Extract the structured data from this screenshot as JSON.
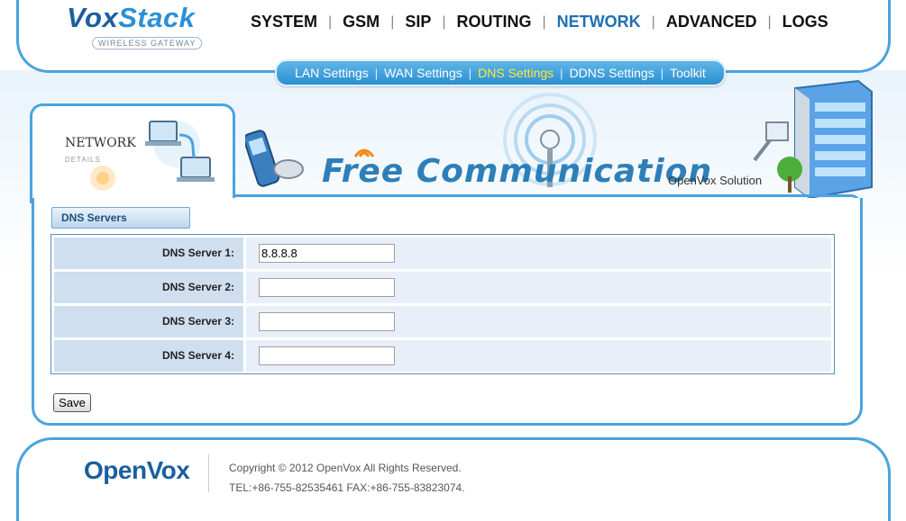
{
  "brand": {
    "name_part1": "Vox",
    "name_part2": "Stack",
    "tagline": "WIRELESS GATEWAY"
  },
  "main_nav": [
    {
      "label": "SYSTEM",
      "active": false
    },
    {
      "label": "GSM",
      "active": false
    },
    {
      "label": "SIP",
      "active": false
    },
    {
      "label": "ROUTING",
      "active": false
    },
    {
      "label": "NETWORK",
      "active": true
    },
    {
      "label": "ADVANCED",
      "active": false
    },
    {
      "label": "LOGS",
      "active": false
    }
  ],
  "sub_nav": [
    {
      "label": "LAN Settings",
      "active": false
    },
    {
      "label": "WAN Settings",
      "active": false
    },
    {
      "label": "DNS Settings",
      "active": true
    },
    {
      "label": "DDNS Settings",
      "active": false
    },
    {
      "label": "Toolkit",
      "active": false
    }
  ],
  "section_badge": {
    "title": "NETWORK",
    "subtitle": "DETAILS"
  },
  "banner": {
    "headline": "Free Communication",
    "note": "OpenVox Solution"
  },
  "dns_section": {
    "title": "DNS Servers",
    "rows": [
      {
        "label": "DNS Server 1:",
        "value": "8.8.8.8"
      },
      {
        "label": "DNS Server 2:",
        "value": ""
      },
      {
        "label": "DNS Server 3:",
        "value": ""
      },
      {
        "label": "DNS Server 4:",
        "value": ""
      }
    ]
  },
  "actions": {
    "save_label": "Save"
  },
  "footer": {
    "logo_part1": "Open",
    "logo_part2": "Vox",
    "copyright": "Copyright © 2012 OpenVox All Rights Reserved.",
    "contact": "TEL:+86-755-82535461 FAX:+86-755-83823074."
  },
  "colors": {
    "accent": "#4aa3df",
    "active_nav": "#1f6fb2",
    "active_subnav": "#ffe83a"
  }
}
